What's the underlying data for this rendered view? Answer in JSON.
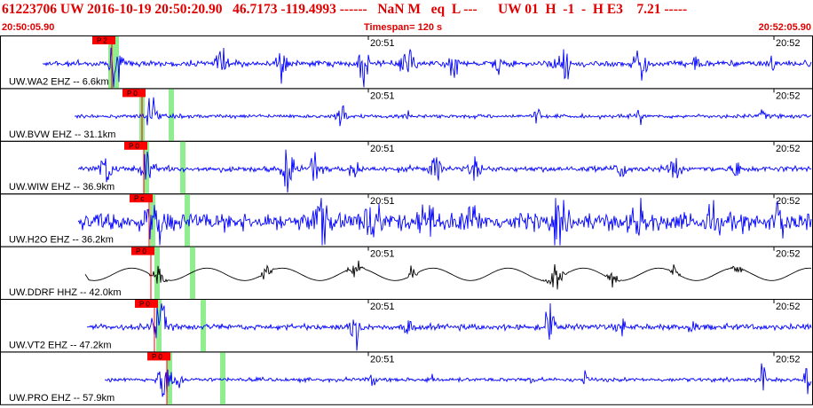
{
  "header": {
    "title": "61223706 UW 2016-10-19 20:50:20.90   46.7173 -119.4993 ------   NaN M   eq  L ---      UW 01  H  -1  -  H E3    7.21 -----",
    "start_time": "20:50:05.90",
    "timespan": "Timespan= 120 s",
    "end_time": "20:52:05.90"
  },
  "colors": {
    "header_text": "#e00000",
    "trace_default": "#0000ff",
    "trace_alt": "#000000",
    "pick": "#ff0000",
    "marker": "#90ee90"
  },
  "time_ticks": [
    "20:51",
    "20:52"
  ],
  "panels": [
    {
      "label": "UW.WA2 EHZ -- 6.6km",
      "pick": "P 2",
      "color": "#0000ff"
    },
    {
      "label": "UW.BVW EHZ -- 31.1km",
      "pick": "P 0",
      "color": "#0000ff"
    },
    {
      "label": "UW.WIW EHZ -- 36.9km",
      "pick": "P 0",
      "color": "#0000ff"
    },
    {
      "label": "UW.H2O EHZ -- 36.2km",
      "pick": "P c",
      "color": "#0000ff"
    },
    {
      "label": "UW.DDRF HHZ -- 42.0km",
      "pick": "P 0",
      "color": "#000000"
    },
    {
      "label": "UW.VT2 EHZ -- 47.2km",
      "pick": "P 0",
      "color": "#0000ff"
    },
    {
      "label": "UW.PRO EHZ -- 57.9km",
      "pick": "P 0",
      "color": "#0000ff"
    }
  ]
}
